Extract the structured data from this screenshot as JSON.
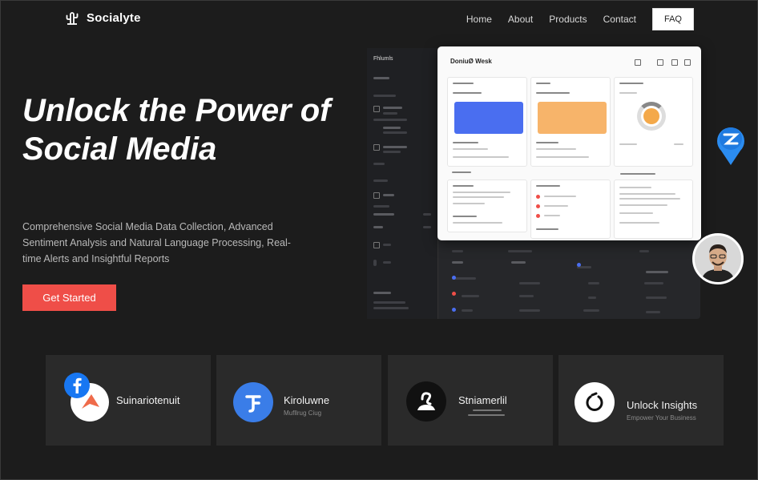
{
  "brand": {
    "name": "Socialyte",
    "icon": "cactus-icon"
  },
  "nav": {
    "items": [
      "Home",
      "About",
      "Products",
      "Contact"
    ],
    "faq_label": "FAQ"
  },
  "hero": {
    "title": "Unlock the Power of Social Media",
    "subtitle": "Comprehensive Social Media Data Collection, Advanced Sentiment Analysis and Natural Language Processing, Real-time Alerts and Insightful Reports",
    "cta_label": "Get Started"
  },
  "dashboard": {
    "sidebar_brand": "Fhlumls",
    "header_title": "DoniuØ Wesk"
  },
  "colors": {
    "accent": "#ef4e48",
    "background": "#1c1c1c",
    "card": "#2a2a2a",
    "blue": "#4a6ef0",
    "orange": "#f7b46a"
  },
  "features": [
    {
      "title": "Suinariotenuit",
      "subtitle": "",
      "icon": "facebook-logo-icon"
    },
    {
      "title": "Kiroluwne",
      "subtitle": "Mufllrug Ciug",
      "icon": "blue-logo-icon"
    },
    {
      "title": "Stniamerlil",
      "subtitle": "",
      "icon": "person-logo-icon"
    },
    {
      "title": "Unlock Insights",
      "subtitle": "Empower Your Business",
      "icon": "loop-logo-icon"
    }
  ]
}
